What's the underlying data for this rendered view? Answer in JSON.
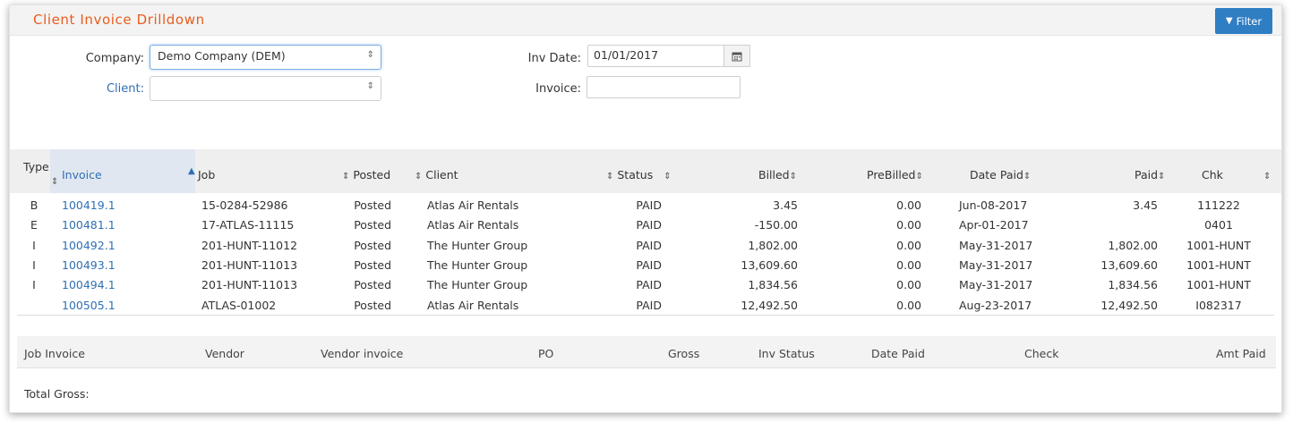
{
  "header": {
    "title": "Client Invoice Drilldown",
    "filter_label": "Filter"
  },
  "form": {
    "company_label": "Company:",
    "company_value": "Demo Company (DEM)",
    "client_label": "Client:",
    "client_value": "",
    "inv_date_label": "Inv Date:",
    "inv_date_value": "01/01/2017",
    "invoice_label": "Invoice:",
    "invoice_value": ""
  },
  "table": {
    "columns": {
      "type": "Type",
      "invoice": "Invoice",
      "job": "Job",
      "posted": "Posted",
      "client": "Client",
      "status": "Status",
      "billed": "Billed",
      "prebilled": "PreBilled",
      "date_paid": "Date Paid",
      "paid": "Paid",
      "chk": "Chk"
    },
    "rows": [
      {
        "type": "B",
        "invoice": "100419.1",
        "job": "15-0284-52986",
        "posted": "Posted",
        "client": "Atlas Air Rentals",
        "status": "PAID",
        "billed": "3.45",
        "prebilled": "0.00",
        "date_paid": "Jun-08-2017",
        "paid": "3.45",
        "chk": "111222"
      },
      {
        "type": "E",
        "invoice": "100481.1",
        "job": "17-ATLAS-11115",
        "posted": "Posted",
        "client": "Atlas Air Rentals",
        "status": "PAID",
        "billed": "-150.00",
        "prebilled": "0.00",
        "date_paid": "Apr-01-2017",
        "paid": "",
        "chk": "0401"
      },
      {
        "type": "I",
        "invoice": "100492.1",
        "job": "201-HUNT-11012",
        "posted": "Posted",
        "client": "The Hunter Group",
        "status": "PAID",
        "billed": "1,802.00",
        "prebilled": "0.00",
        "date_paid": "May-31-2017",
        "paid": "1,802.00",
        "chk": "1001-HUNT"
      },
      {
        "type": "I",
        "invoice": "100493.1",
        "job": "201-HUNT-11013",
        "posted": "Posted",
        "client": "The Hunter Group",
        "status": "PAID",
        "billed": "13,609.60",
        "prebilled": "0.00",
        "date_paid": "May-31-2017",
        "paid": "13,609.60",
        "chk": "1001-HUNT"
      },
      {
        "type": "I",
        "invoice": "100494.1",
        "job": "201-HUNT-11013",
        "posted": "Posted",
        "client": "The Hunter Group",
        "status": "PAID",
        "billed": "1,834.56",
        "prebilled": "0.00",
        "date_paid": "May-31-2017",
        "paid": "1,834.56",
        "chk": "1001-HUNT"
      },
      {
        "type": "",
        "invoice": "100505.1",
        "job": "ATLAS-01002",
        "posted": "Posted",
        "client": "Atlas Air Rentals",
        "status": "PAID",
        "billed": "12,492.50",
        "prebilled": "0.00",
        "date_paid": "Aug-23-2017",
        "paid": "12,492.50",
        "chk": "I082317"
      }
    ]
  },
  "sub_table": {
    "columns": [
      "Job Invoice",
      "Vendor",
      "Vendor invoice",
      "PO",
      "Gross",
      "Inv Status",
      "Date Paid",
      "Check",
      "Amt Paid"
    ]
  },
  "footer": {
    "total_gross_label": "Total Gross:"
  },
  "icons": {
    "filter": "filter-icon",
    "calendar": "calendar-icon",
    "sort": "sort-icon"
  },
  "colors": {
    "title": "#e85d1c",
    "accent": "#2f7ec4",
    "link": "#2f6fb5"
  }
}
